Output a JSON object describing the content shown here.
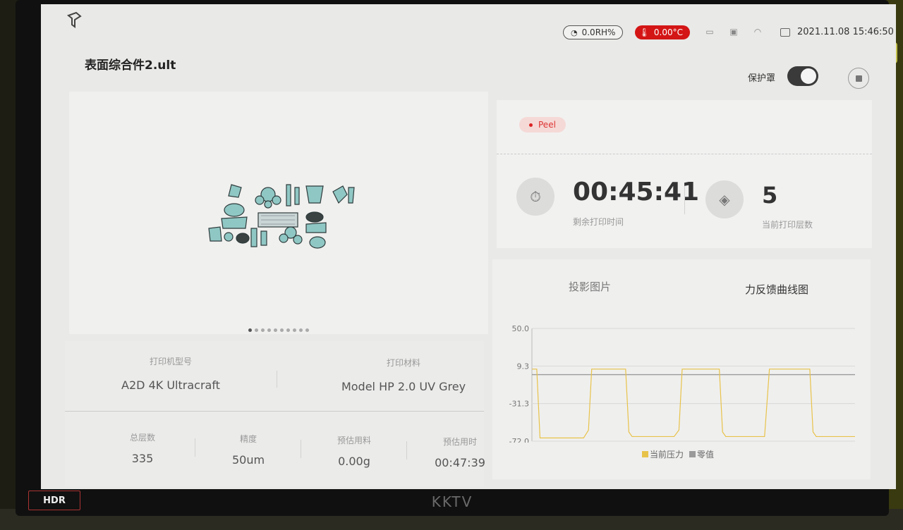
{
  "status_bar": {
    "humidity": "0.0RH%",
    "temperature": "0.00°C",
    "datetime": "2021.11.08 15:46:50"
  },
  "file_name": "表面综合件2.ult",
  "cover": {
    "label": "保护罩",
    "enabled": true
  },
  "printer": {
    "model_label": "打印机型号",
    "model_value": "A2D 4K Ultracraft",
    "material_label": "打印材料",
    "material_value": "Model HP 2.0 UV Grey"
  },
  "stats": [
    {
      "label": "总层数",
      "value": "335"
    },
    {
      "label": "精度",
      "value": "50um"
    },
    {
      "label": "预估用料",
      "value": "0.00g"
    },
    {
      "label": "预估用时",
      "value": "00:47:39"
    }
  ],
  "preview": {
    "page_count": 10,
    "active_page": 0
  },
  "status": {
    "phase": "Peel",
    "remaining_time": "00:45:41",
    "remaining_label": "剩余打印时间",
    "current_layer": "5",
    "current_layer_label": "当前打印层数"
  },
  "tabs": {
    "projection": "投影图片",
    "force_curve": "力反馈曲线图"
  },
  "chart_data": {
    "type": "line",
    "y_ticks": [
      "50.0",
      "9.3",
      "-31.3",
      "-72.0"
    ],
    "ylim": [
      -72.0,
      50.0
    ],
    "xlim": [
      0,
      100
    ],
    "series": [
      {
        "name": "当前压力",
        "color": "#e8c34a",
        "x": [
          0,
          1.5,
          2.5,
          16,
          17.5,
          18.5,
          29,
          30,
          31,
          44,
          45.5,
          46.5,
          58,
          59,
          60,
          72,
          73.5,
          74.5,
          86,
          87,
          88,
          100
        ],
        "y": [
          6,
          6,
          -68.5,
          -68.5,
          -60,
          6,
          6,
          -62,
          -67,
          -67,
          -60,
          6,
          6,
          -62,
          -67,
          -67,
          6,
          6,
          6,
          -62,
          -67,
          -67
        ]
      },
      {
        "name": "零值",
        "color": "#9a9a9a",
        "x": [
          0,
          100
        ],
        "y": [
          0,
          0
        ]
      }
    ],
    "legend": [
      "当前压力",
      "零值"
    ]
  }
}
